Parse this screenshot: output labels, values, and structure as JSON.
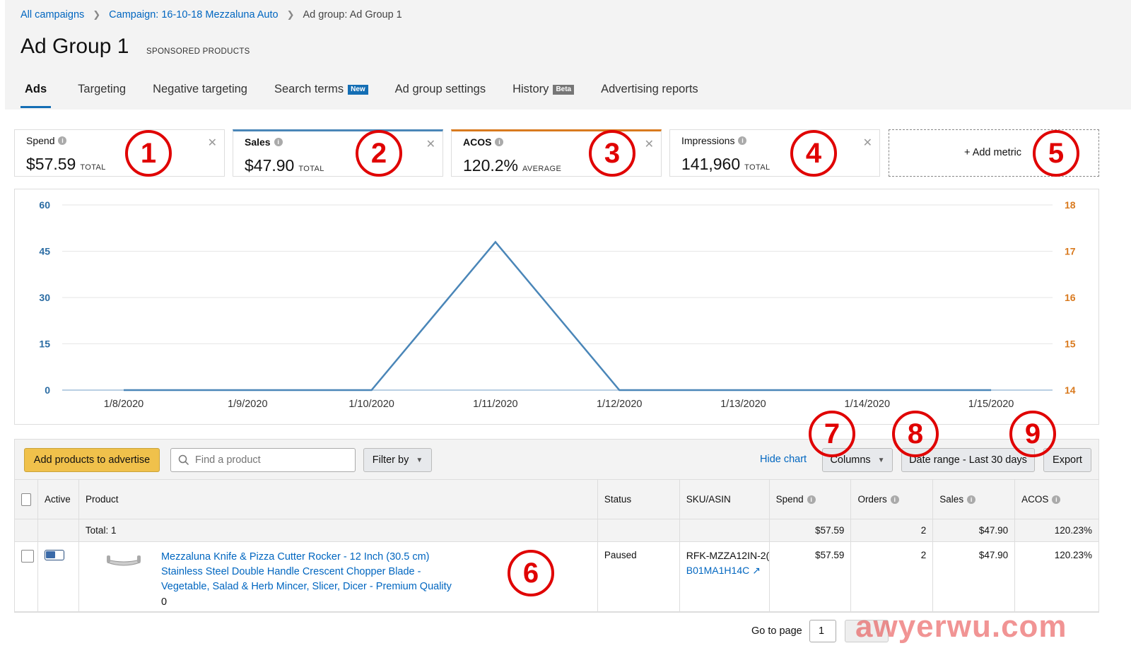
{
  "breadcrumb": {
    "items": [
      "All campaigns",
      "Campaign: 16-10-18 Mezzaluna Auto"
    ],
    "current": "Ad group: Ad Group 1"
  },
  "page": {
    "title": "Ad Group 1",
    "subtitle": "SPONSORED PRODUCTS"
  },
  "tabs": [
    {
      "label": "Ads",
      "active": true
    },
    {
      "label": "Targeting"
    },
    {
      "label": "Negative targeting"
    },
    {
      "label": "Search terms",
      "badge": "New"
    },
    {
      "label": "Ad group settings"
    },
    {
      "label": "History",
      "badge": "Beta"
    },
    {
      "label": "Advertising reports"
    }
  ],
  "metrics": [
    {
      "label": "Spend",
      "value": "$57.59",
      "suffix": "TOTAL"
    },
    {
      "label": "Sales",
      "value": "$47.90",
      "suffix": "TOTAL"
    },
    {
      "label": "ACOS",
      "value": "120.2%",
      "suffix": "AVERAGE"
    },
    {
      "label": "Impressions",
      "value": "141,960",
      "suffix": "TOTAL"
    }
  ],
  "add_metric": "+ Add metric",
  "annotations": [
    "1",
    "2",
    "3",
    "4",
    "5",
    "6",
    "7",
    "8",
    "9"
  ],
  "chart_data": {
    "type": "line",
    "categories": [
      "1/8/2020",
      "1/9/2020",
      "1/10/2020",
      "1/11/2020",
      "1/12/2020",
      "1/13/2020",
      "1/14/2020",
      "1/15/2020"
    ],
    "series": [
      {
        "values": [
          0,
          0,
          0,
          48,
          0,
          0,
          0,
          0
        ],
        "axis": "left",
        "color": "#4a86b8"
      }
    ],
    "ylim_left": [
      0,
      60
    ],
    "yticks_left": [
      "0",
      "15",
      "30",
      "45",
      "60"
    ],
    "ylim_right": [
      14,
      18
    ],
    "yticks_right": [
      "14",
      "15",
      "16",
      "17",
      "18"
    ],
    "left_color": "#2b6ca3",
    "right_color": "#d97a1f",
    "grid": true
  },
  "toolbar": {
    "add_products": "Add products to advertise",
    "search_placeholder": "Find a product",
    "filter_by": "Filter by",
    "hide_chart": "Hide chart",
    "columns": "Columns",
    "date_range": "Date range - Last 30 days",
    "export": "Export"
  },
  "table": {
    "headers": [
      "Active",
      "Product",
      "Status",
      "SKU/ASIN",
      "Spend",
      "Orders",
      "Sales",
      "ACOS"
    ],
    "total": {
      "label": "Total: 1",
      "spend": "$57.59",
      "orders": "2",
      "sales": "$47.90",
      "acos": "120.23%"
    },
    "rows": [
      {
        "product": "Mezzaluna Knife & Pizza Cutter Rocker - 12 Inch (30.5 cm) Stainless Steel Double Handle Crescent Chopper Blade - Vegetable, Salad & Herb Mincer, Slicer, Dicer - Premium Quality",
        "product_extra": "0",
        "status": "Paused",
        "sku": "RFK-MZZA12IN-2(",
        "asin": "B01MA1H14C",
        "spend": "$57.59",
        "orders": "2",
        "sales": "$47.90",
        "acos": "120.23%"
      }
    ]
  },
  "pagination": {
    "goto_label": "Go to page",
    "page": "1"
  },
  "watermark": "awyerwu.com"
}
